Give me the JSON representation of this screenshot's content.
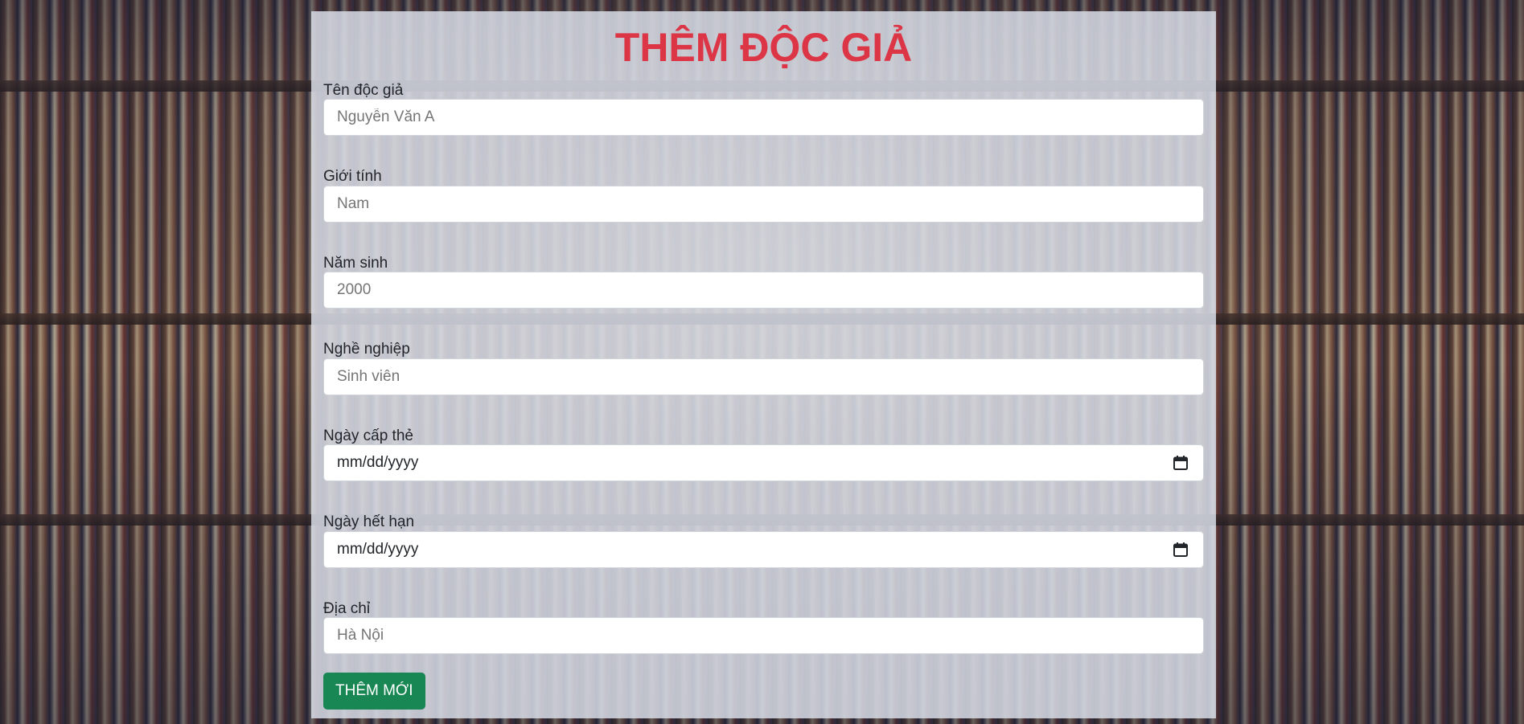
{
  "page": {
    "title": "THÊM ĐỘC GIẢ"
  },
  "form": {
    "fields": [
      {
        "label": "Tên độc giả",
        "placeholder": "Nguyễn Văn A",
        "type": "text"
      },
      {
        "label": "Giới tính",
        "placeholder": "Nam",
        "type": "text"
      },
      {
        "label": "Năm sinh",
        "placeholder": "2000",
        "type": "text"
      },
      {
        "label": "Nghề nghiệp",
        "placeholder": "Sinh viên",
        "type": "text"
      },
      {
        "label": "Ngày cấp thẻ",
        "placeholder": "mm/dd/yyyy",
        "type": "date"
      },
      {
        "label": "Ngày hết hạn",
        "placeholder": "mm/dd/yyyy",
        "type": "date"
      },
      {
        "label": "Địa chỉ",
        "placeholder": "Hà Nội",
        "type": "text"
      }
    ],
    "submit_label": "THÊM MỚI"
  },
  "colors": {
    "title": "#dc3545",
    "submit_button": "#198754",
    "panel": "#d7dce6"
  },
  "icons": {
    "date_picker": "calendar-icon"
  }
}
